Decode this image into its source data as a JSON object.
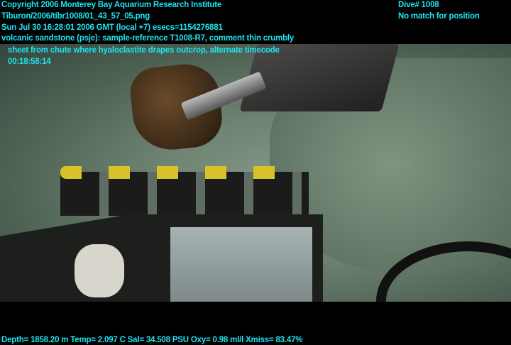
{
  "overlay": {
    "copyright": "Copyright 2006 Monterey Bay Aquarium Research Institute",
    "file": "Tiburon/2006/tibr1008/01_43_57_05.png",
    "datetime": "Sun Jul 30 16:28:01 2006 GMT (local +7)  esecs=1154276881",
    "comment_line1": "volcanic sandstone (psje): sample-reference T1008-R7, comment thin crumbly",
    "comment_line2": "sheet from chute where hyaloclastite drapes outcrop, alternate timecode",
    "comment_line3": "00:18:58:14",
    "dive": "Dive# 1008",
    "position": "No match for position",
    "sensors": "Depth= 1858.20 m  Temp= 2.097 C  Sal= 34.508 PSU  Oxy= 0.98 ml/l  Xmiss= 83.47%"
  },
  "colors": {
    "overlay_text": "#1fe3f0"
  }
}
